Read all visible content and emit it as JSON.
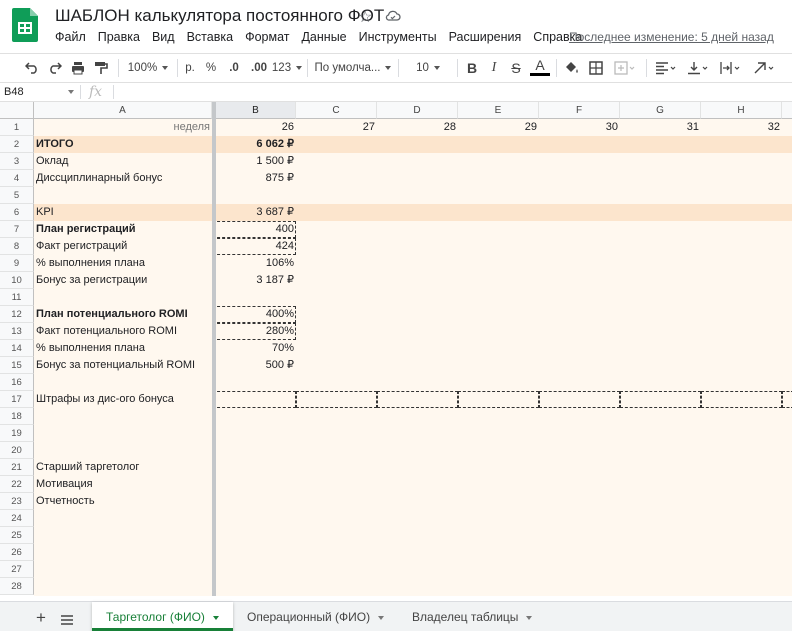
{
  "app": {
    "title": "ШАБЛОН калькулятора постоянного ФОТ",
    "last_edit": "Последнее изменение: 5 дней назад",
    "brand_color": "#0f9d58"
  },
  "menu": [
    "Файл",
    "Правка",
    "Вид",
    "Вставка",
    "Формат",
    "Данные",
    "Инструменты",
    "Расширения",
    "Справка"
  ],
  "toolbar": {
    "zoom": "100%",
    "currency": "р.",
    "percent": "%",
    "dec_less": ".0",
    "dec_more": ".00",
    "more_formats": "123",
    "font": "По умолча...",
    "font_size": "10",
    "bold": "B",
    "italic": "I",
    "strike": "S",
    "text_color": "A"
  },
  "formula_bar": {
    "name_box": "B48",
    "fx": "fx",
    "value": ""
  },
  "columns": [
    "A",
    "B",
    "C",
    "D",
    "E",
    "F",
    "G",
    "H"
  ],
  "rows": [
    "1",
    "2",
    "3",
    "4",
    "5",
    "6",
    "7",
    "8",
    "9",
    "10",
    "11",
    "12",
    "13",
    "14",
    "15",
    "16",
    "17",
    "18",
    "19",
    "20",
    "21",
    "22",
    "23",
    "24",
    "25",
    "26",
    "27",
    "28"
  ],
  "cells": {
    "a1": "неделя",
    "b1": "26",
    "c1": "27",
    "d1": "28",
    "e1": "29",
    "f1": "30",
    "g1": "31",
    "h1": "32",
    "a2": "ИТОГО",
    "b2": "6 062 ₽",
    "a3": "Оклад",
    "b3": "1 500 ₽",
    "a4": "Диссциплинарный бонус",
    "b4": "875 ₽",
    "a6": "KPI",
    "b6": "3 687 ₽",
    "a7": "План регистраций",
    "b7": "400",
    "a8": "Факт регистраций",
    "b8": "424",
    "a9": "% выполнения плана",
    "b9": "106%",
    "a10": "Бонус за регистрации",
    "b10": "3 187 ₽",
    "a12": "План потенциального ROMI",
    "b12": "400%",
    "a13": "Факт потенциального ROMI",
    "b13": "280%",
    "a14": "% выполнения плана",
    "b14": "70%",
    "a15": "Бонус за потенциальный ROMI",
    "b15": "500 ₽",
    "a17": "Штрафы из дис-ого бонуса",
    "a21": "Старший таргетолог",
    "a22": "Мотивация",
    "a23": "Отчетность"
  },
  "sheets": {
    "tab1": "Таргетолог (ФИО)",
    "tab2": "Операционный (ФИО)",
    "tab3": "Владелец таблицы"
  },
  "colors": {
    "band": "#fce5cd",
    "sheet_bg": "#fff8ef",
    "active_tab": "#188038"
  }
}
